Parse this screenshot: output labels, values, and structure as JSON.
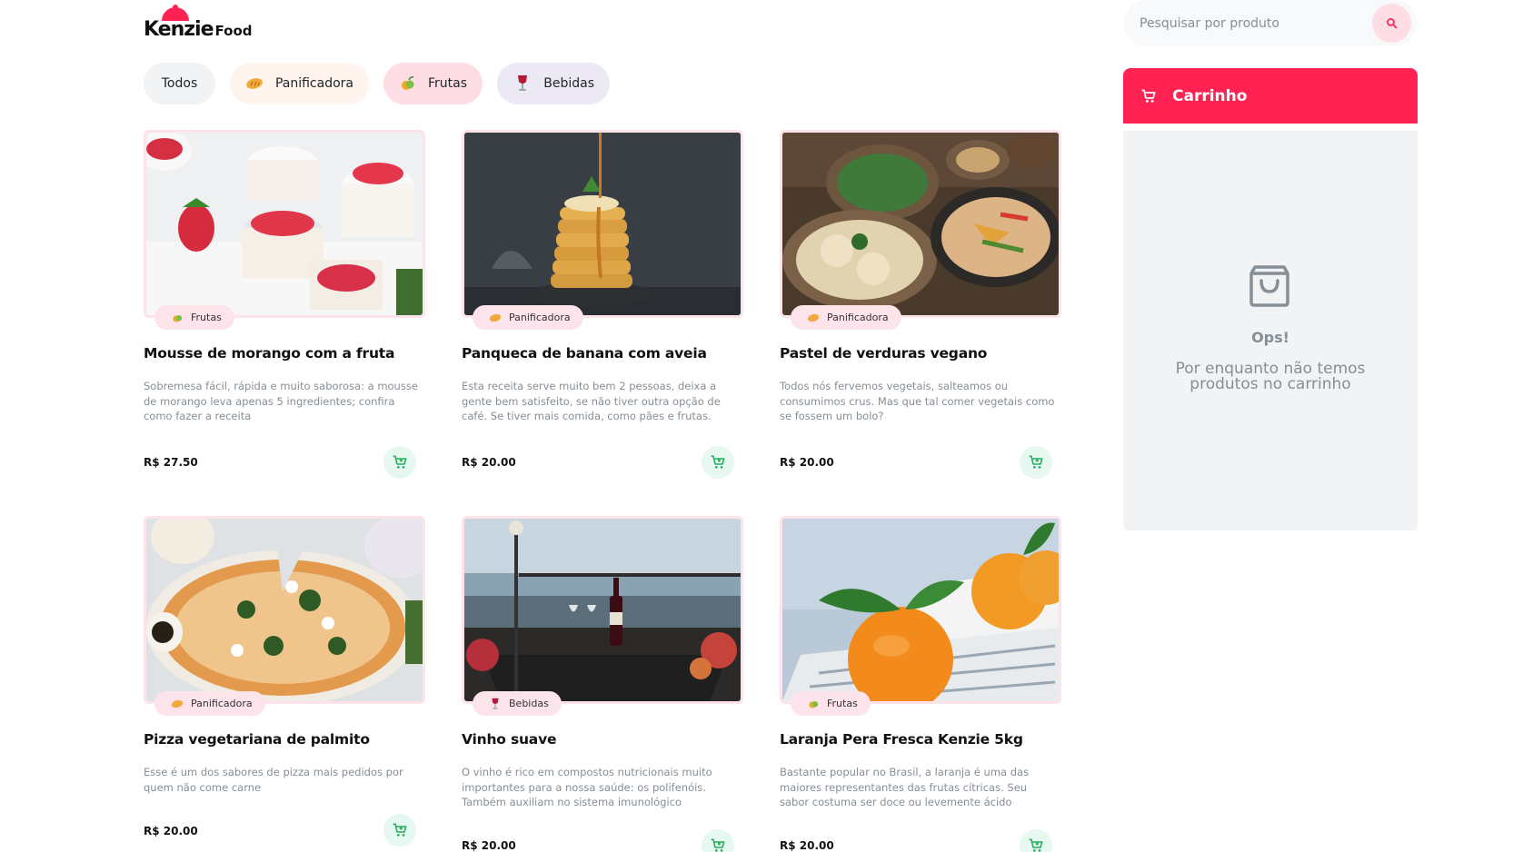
{
  "brand": {
    "name": "Kenzie",
    "suffix": "Food",
    "color": "#ff2253"
  },
  "filters": [
    {
      "label": "Todos",
      "icon": ""
    },
    {
      "label": "Panificadora",
      "icon": "bread-icon"
    },
    {
      "label": "Frutas",
      "icon": "fruit-icon"
    },
    {
      "label": "Bebidas",
      "icon": "wine-icon"
    }
  ],
  "search": {
    "placeholder": "Pesquisar por produto",
    "value": ""
  },
  "cart": {
    "title": "Carrinho",
    "empty_title": "Ops!",
    "empty_message": "Por enquanto não temos produtos no carrinho"
  },
  "products": [
    {
      "title": "Mousse de morango com a fruta",
      "category": "Frutas",
      "description": "Sobremesa fácil, rápida e muito saborosa: a mousse de morango leva apenas 5 ingredientes; confira como fazer a receita",
      "price": "R$ 27.50"
    },
    {
      "title": "Panqueca de banana com aveia",
      "category": "Panificadora",
      "description": "Esta receita serve muito bem 2 pessoas, deixa a gente bem satisfeito, se não tiver outra opção de café. Se tiver mais comida, como pães e frutas.",
      "price": "R$ 20.00"
    },
    {
      "title": "Pastel de verduras vegano",
      "category": "Panificadora",
      "description": "Todos nós fervemos vegetais, salteamos ou consumimos crus. Mas que tal comer vegetais como se fossem um bolo?",
      "price": "R$ 20.00"
    },
    {
      "title": "Pizza vegetariana de palmito",
      "category": "Panificadora",
      "description": "Esse é um dos sabores de pizza mais pedidos por quem não come carne",
      "price": "R$ 20.00"
    },
    {
      "title": "Vinho suave",
      "category": "Bebidas",
      "description": "O vinho é rico em compostos nutricionais muito importantes para a nossa saúde: os polifenóis. Também auxiliam no sistema imunológico",
      "price": "R$ 20.00"
    },
    {
      "title": "Laranja Pera Fresca Kenzie 5kg",
      "category": "Frutas",
      "description": "Bastante popular no Brasil, a laranja é uma das maiores representantes das frutas cítricas. Seu sabor costuma ser doce ou levemente ácido",
      "price": "R$ 20.00"
    }
  ],
  "colors": {
    "accent": "#ff2253",
    "add_button": "#27ae60",
    "tag_bg": "#fde3ea"
  }
}
